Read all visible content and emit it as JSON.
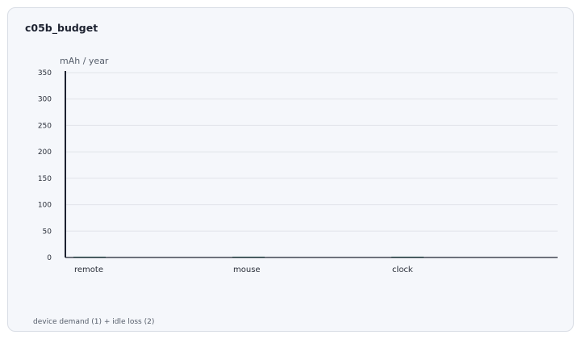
{
  "chart_data": {
    "type": "bar",
    "title": "c05b_budget",
    "xlabel": "",
    "ylabel": "mAh / year",
    "ylim": [
      0,
      350
    ],
    "yticks": [
      0,
      50,
      100,
      150,
      200,
      250,
      300,
      350
    ],
    "categories": [
      "remote",
      "mouse",
      "clock"
    ],
    "series": [
      {
        "values": [
          1.5,
          1.5,
          1.5
        ],
        "color": "#1f7a5a"
      },
      {
        "values": [
          0.8,
          0.8,
          0.8
        ],
        "color": "#2fae80"
      }
    ],
    "grid": true,
    "caption": "device demand (1) + idle loss (2)"
  }
}
